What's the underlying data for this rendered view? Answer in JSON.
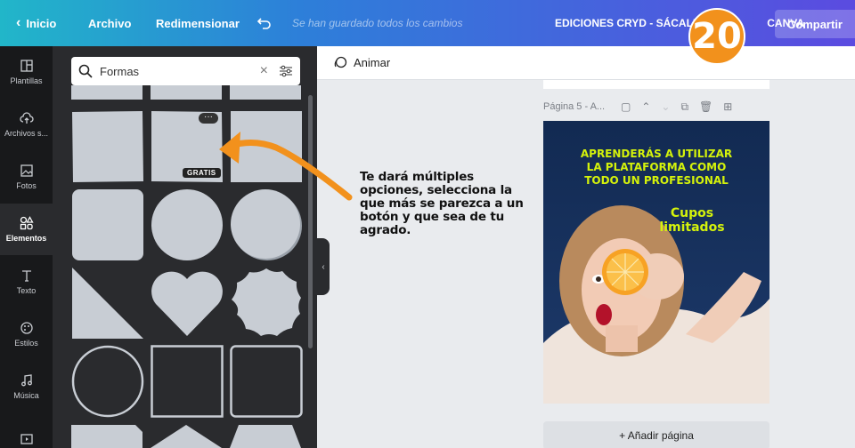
{
  "topbar": {
    "back_label": "Inicio",
    "file_label": "Archivo",
    "resize_label": "Redimensionar",
    "saved_status": "Se han guardado todos los cambios",
    "title": "EDICIONES CRYD - SÁCALE P",
    "title_suffix": "CANVA",
    "share_label": "Compartir",
    "step_badge": "20"
  },
  "leftnav": {
    "items": [
      {
        "label": "Plantillas",
        "icon": "templates-icon"
      },
      {
        "label": "Archivos s...",
        "icon": "upload-cloud-icon"
      },
      {
        "label": "Fotos",
        "icon": "photo-icon"
      },
      {
        "label": "Elementos",
        "icon": "elements-icon",
        "active": true
      },
      {
        "label": "Texto",
        "icon": "text-icon"
      },
      {
        "label": "Estilos",
        "icon": "palette-icon"
      },
      {
        "label": "Música",
        "icon": "music-icon"
      },
      {
        "label": "",
        "icon": "video-icon"
      }
    ]
  },
  "panel": {
    "search_value": "Formas",
    "badge_free": "GRATIS",
    "more": "···"
  },
  "canvas": {
    "animate_label": "Animar",
    "page_label": "Página 5 - A...",
    "add_page_label": "+ Añadir página",
    "design": {
      "headline_1": "APRENDERÁS A UTILIZAR",
      "headline_2": "LA PLATAFORMA COMO",
      "headline_3": "TODO UN PROFESIONAL",
      "cupos_1": "Cupos",
      "cupos_2": "limitados"
    }
  },
  "callout": {
    "text": "Te dará múltiples opciones, selecciona la que más se parezca a un botón y que sea de tu agrado."
  },
  "colors": {
    "accent_orange": "#f2911c",
    "shape_fill": "#c8cdd4",
    "panel_bg": "#2a2b2e",
    "design_text": "#d4f20b"
  }
}
